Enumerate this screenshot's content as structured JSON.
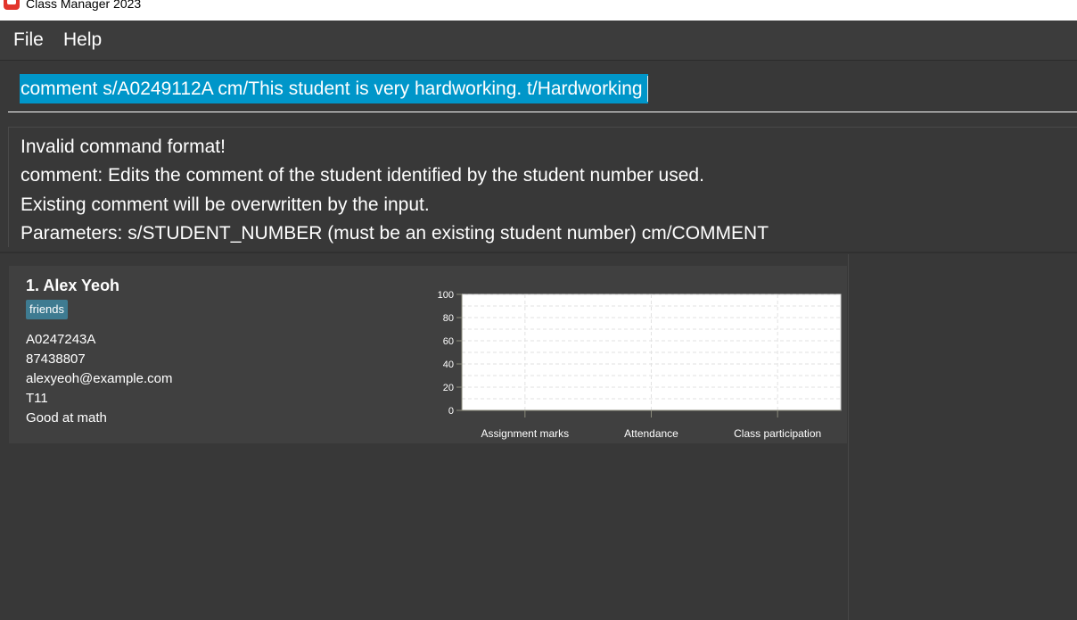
{
  "window": {
    "title": "Class Manager 2023"
  },
  "menu": {
    "file": "File",
    "help": "Help"
  },
  "command": {
    "value": "comment s/A0249112A cm/This student is very hardworking. t/Hardworking"
  },
  "result": {
    "lines": [
      "Invalid command format!",
      "comment: Edits the comment of the student identified by the student number used.",
      "Existing comment will be overwritten by the input.",
      "Parameters: s/STUDENT_NUMBER (must be an existing student number) cm/COMMENT"
    ]
  },
  "students": [
    {
      "name": "1.  Alex Yeoh",
      "tags": [
        "friends"
      ],
      "student_number": "A0247243A",
      "phone": "87438807",
      "email": "alexyeoh@example.com",
      "class_number": "T11",
      "comment": "Good at math"
    }
  ],
  "colors": {
    "accent": "#0096c9",
    "tag": "#3e7b91",
    "background": "#383838",
    "card": "#404040"
  },
  "chart_data": {
    "type": "bar",
    "categories": [
      "Assignment marks",
      "Attendance",
      "Class participation"
    ],
    "values": [
      0,
      0,
      0
    ],
    "ylim": [
      0,
      100
    ],
    "yticks": [
      0,
      20,
      40,
      60,
      80,
      100
    ],
    "grid": true
  }
}
